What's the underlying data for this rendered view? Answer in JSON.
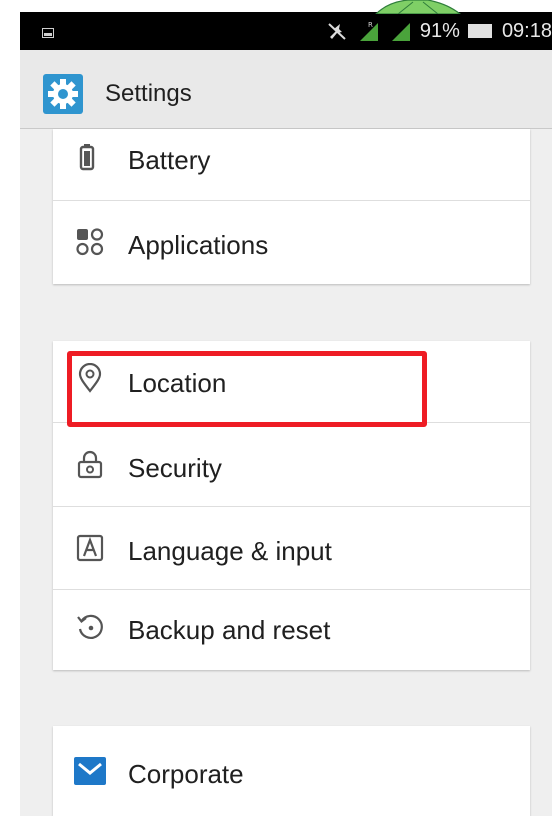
{
  "status_bar": {
    "battery_percent": "91%",
    "time": "09:18"
  },
  "action_bar": {
    "title": "Settings",
    "icon": "gear-icon"
  },
  "settings": {
    "battery": {
      "label": "Battery",
      "icon": "battery-icon"
    },
    "applications": {
      "label": "Applications",
      "icon": "apps-grid-icon"
    },
    "location": {
      "label": "Location",
      "icon": "location-pin-icon"
    },
    "security": {
      "label": "Security",
      "icon": "lock-icon"
    },
    "language": {
      "label": "Language & input",
      "icon": "keyboard-a-icon"
    },
    "backup": {
      "label": "Backup and reset",
      "icon": "restore-icon"
    },
    "corporate": {
      "label": "Corporate",
      "icon": "mail-icon"
    }
  },
  "colors": {
    "highlight": "#ee1c24",
    "accent": "#2f95cf",
    "background": "#efefef"
  }
}
